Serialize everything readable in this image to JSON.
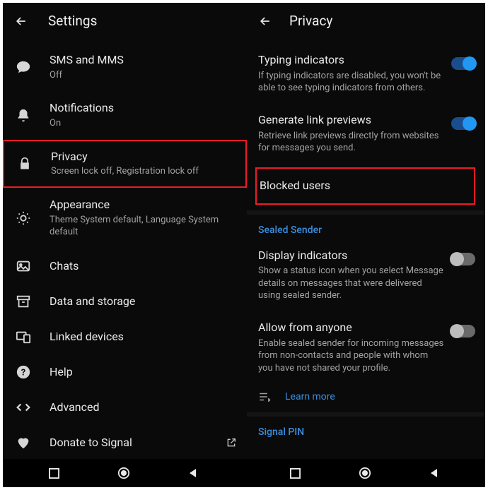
{
  "left": {
    "headerTitle": "Settings",
    "items": [
      {
        "icon": "chat",
        "title": "SMS and MMS",
        "sub": "Off"
      },
      {
        "icon": "bell",
        "title": "Notifications",
        "sub": "On"
      },
      {
        "icon": "lock",
        "title": "Privacy",
        "sub": "Screen lock off, Registration lock off",
        "highlighted": true
      },
      {
        "icon": "sun",
        "title": "Appearance",
        "sub": "Theme System default, Language System default"
      },
      {
        "icon": "image",
        "title": "Chats",
        "sub": ""
      },
      {
        "icon": "archive",
        "title": "Data and storage",
        "sub": ""
      },
      {
        "icon": "devices",
        "title": "Linked devices",
        "sub": ""
      },
      {
        "icon": "help",
        "title": "Help",
        "sub": ""
      },
      {
        "icon": "code",
        "title": "Advanced",
        "sub": ""
      },
      {
        "icon": "heart",
        "title": "Donate to Signal",
        "sub": "",
        "external": true
      }
    ]
  },
  "right": {
    "headerTitle": "Privacy",
    "rows": {
      "typing": {
        "title": "Typing indicators",
        "sub": "If typing indicators are disabled, you won't be able to see typing indicators from others.",
        "on": true
      },
      "linkPreviews": {
        "title": "Generate link previews",
        "sub": "Retrieve link previews directly from websites for messages you send.",
        "on": true
      },
      "blocked": {
        "title": "Blocked users",
        "highlighted": true
      },
      "sealedHeader": "Sealed Sender",
      "displayIndicators": {
        "title": "Display indicators",
        "sub": "Show a status icon when you select Message details on messages that were delivered using sealed sender.",
        "on": false
      },
      "allowAnyone": {
        "title": "Allow from anyone",
        "sub": "Enable sealed sender for incoming messages from non-contacts and people with whom you have not shared your profile.",
        "on": false
      },
      "learnMore": "Learn more",
      "signalPin": "Signal PIN"
    }
  }
}
